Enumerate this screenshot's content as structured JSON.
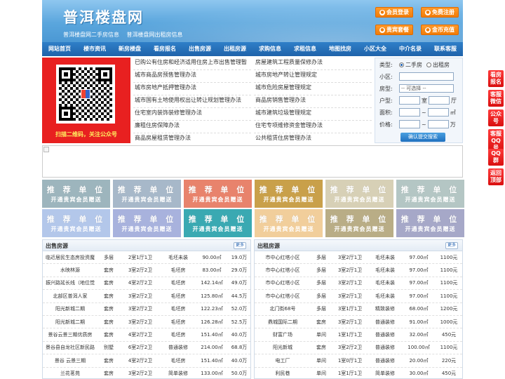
{
  "header": {
    "logo": "普洱楼盘网",
    "sublinks": [
      "普洱楼盘网二手房信息",
      "普洱楼盘网出租房信息"
    ],
    "buttons": [
      {
        "label": "会员登录",
        "icon": "user-icon"
      },
      {
        "label": "免费注册",
        "icon": "register-icon"
      },
      {
        "label": "贵宾套餐",
        "icon": "vip-icon"
      },
      {
        "label": "金币充值",
        "icon": "coin-icon"
      }
    ]
  },
  "nav": [
    "网站首页",
    "楼市资讯",
    "新房楼盘",
    "看房报名",
    "出售房源",
    "出租房源",
    "求购信息",
    "求租信息",
    "地图找房",
    "小区大全",
    "中介名录",
    "联系客服"
  ],
  "qr": {
    "caption": "扫描二维码，关注公众号"
  },
  "news_left": [
    "已购公有住房和经济适用住房上市出售管理暂",
    "城市商品房预售管理办法",
    "城市房地产抵押管理办法",
    "城市国有土地使用权出让转让规划管理办法",
    "住宅室内装饰装修管理办法",
    "廉租住房保障办法",
    "商品房屋租赁管理办法"
  ],
  "news_right": [
    "房屋建筑工程质量保修办法",
    "城市房地产转让管理规定",
    "城市危险房屋管理规定",
    "商品房销售管理办法",
    "城市建筑垃圾管理规定",
    "住宅专项维修资金管理办法",
    "公共租赁住房管理办法"
  ],
  "search": {
    "type_label": "类型:",
    "type_options": [
      "二手房",
      "出租房"
    ],
    "community_label": "小区:",
    "house_label": "房型:",
    "house_value": "-- 可选择 --",
    "layout_label": "户型:",
    "room_unit": "室",
    "hall_unit": "厅",
    "area_label": "面积:",
    "area_unit": "㎡",
    "price_label": "价格:",
    "price_unit": "万",
    "tilde": "~",
    "submit": "确认提交搜索"
  },
  "tiles": {
    "title": "推 荐 单 位",
    "subtitle": "开通贵宾会员赠送",
    "colors": [
      "#9db5bd",
      "#a7b8c9",
      "#e8836c",
      "#c9a04a",
      "#d7d0b6",
      "#b4c6c4",
      "#b3c7ea",
      "#a8b2dd",
      "#3aa9b2",
      "#f1ce9b",
      "#b9ad86",
      "#a6a8c8"
    ]
  },
  "sale": {
    "title": "出售房源",
    "more": "更多",
    "rows": [
      [
        "临近居民生态房投资魔",
        "多层",
        "2室1厅1卫",
        "毛坯未装",
        "90.00㎡",
        "19.0万"
      ],
      [
        "水映林源",
        "套房",
        "3室2厅2卫",
        "毛坯房",
        "83.00㎡",
        "29.0万"
      ],
      [
        "振兴路延长线（地位觉",
        "套房",
        "4室2厅2卫",
        "毛坯房",
        "142.14㎡",
        "49.0万"
      ],
      [
        "北部区普洱人家",
        "套房",
        "3室2厅2卫",
        "毛坯房",
        "125.80㎡",
        "44.5万"
      ],
      [
        "阳光新城二期",
        "套房",
        "3室2厅2卫",
        "毛坯房",
        "122.23㎡",
        "52.0万"
      ],
      [
        "阳光新城二期",
        "套房",
        "3室2厅2卫",
        "毛坯房",
        "126.28㎡",
        "52.5万"
      ],
      [
        "景谷云景三期优质房",
        "套房",
        "4室2厅2卫",
        "毛坯房",
        "151.40㎡",
        "40.0万"
      ],
      [
        "景谷县自龙社区新民路",
        "别墅",
        "6室2厅2卫",
        "普通装修",
        "214.00㎡",
        "68.8万"
      ],
      [
        "景谷 云景三期",
        "套房",
        "4室2厅2卫",
        "毛坯房",
        "151.40㎡",
        "40.0万"
      ],
      [
        "兰花茗苑",
        "套房",
        "3室2厅2卫",
        "简单装修",
        "133.00㎡",
        "50.0万"
      ]
    ]
  },
  "rent": {
    "title": "出租房源",
    "more": "更多",
    "rows": [
      [
        "市中心红塔小区",
        "多层",
        "3室2厅1卫",
        "毛坯未装",
        "97.00㎡",
        "1100元"
      ],
      [
        "市中心红塔小区",
        "多层",
        "3室2厅1卫",
        "毛坯未装",
        "97.00㎡",
        "1100元"
      ],
      [
        "市中心红塔小区",
        "多层",
        "3室2厅1卫",
        "毛坯未装",
        "97.00㎡",
        "1100元"
      ],
      [
        "市中心红塔小区",
        "多层",
        "3室2厅1卫",
        "毛坯未装",
        "97.00㎡",
        "1100元"
      ],
      [
        "北门街68号",
        "多层",
        "3室1厅1卫",
        "精致装修",
        "68.00㎡",
        "1200元"
      ],
      [
        "鼎城国际二期",
        "套房",
        "3室2厅1卫",
        "普通装修",
        "91.00㎡",
        "1000元"
      ],
      [
        "财富广场",
        "单间",
        "1室1厅1卫",
        "普通装修",
        "32.00㎡",
        "450元"
      ],
      [
        "阳光新城",
        "套房",
        "3室2厅2卫",
        "普通装修",
        "100.00㎡",
        "1100元"
      ],
      [
        "电工厂",
        "单间",
        "1室0厅1卫",
        "普通装修",
        "20.00㎡",
        "220元"
      ],
      [
        "利民巷",
        "单间",
        "1室1厅1卫",
        "简单装修",
        "30.00㎡",
        "450元"
      ]
    ]
  },
  "float_side": [
    "看房报名",
    "客服微信",
    "公众号",
    "客服QQ号",
    "QQ群",
    "返回顶部"
  ]
}
